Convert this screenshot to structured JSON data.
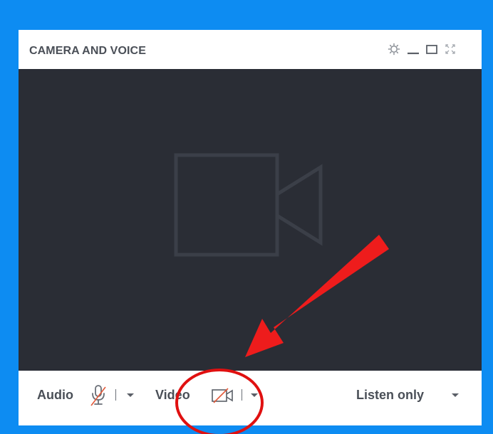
{
  "window": {
    "title": "CAMERA AND VOICE",
    "header_icons": [
      "settings-icon",
      "minimize-icon",
      "maximize-icon",
      "fullscreen-icon"
    ]
  },
  "video": {
    "placeholder_icon": "video-camera-icon",
    "background": "#2a2d35"
  },
  "footer": {
    "audio_label": "Audio",
    "audio_icon": "microphone-muted-icon",
    "video_label": "Video",
    "video_icon": "camera-off-icon",
    "listen_label": "Listen only"
  },
  "annotations": {
    "arrow_color": "#ee1c1c",
    "circle_color": "#e01010"
  },
  "colors": {
    "frame_blue": "#0d8cf2",
    "text_gray": "#4a4f57",
    "muted_red": "#e35a3a"
  }
}
